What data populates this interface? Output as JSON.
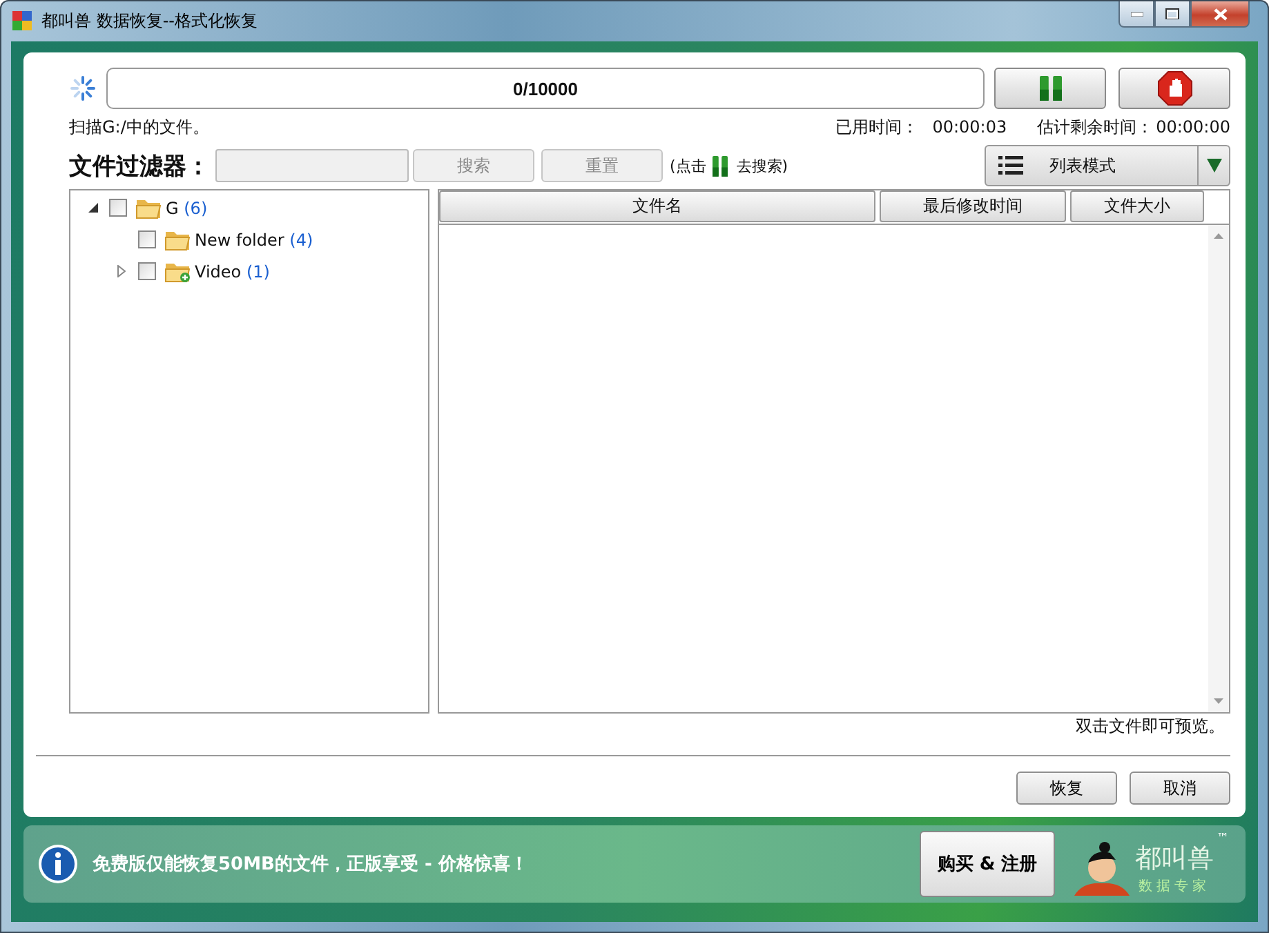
{
  "window": {
    "title": "都叫兽 数据恢复--格式化恢复"
  },
  "progress": {
    "text": "0/10000",
    "level": 0
  },
  "status": {
    "scan_text": "扫描G:/中的文件。",
    "elapsed_label": "已用时间：",
    "elapsed": "00:00:03",
    "remaining_label": "估计剩余时间：",
    "remaining": "00:00:00"
  },
  "filter": {
    "label": "文件过滤器：",
    "disabled": true,
    "search_button": "搜索",
    "reset_button": "重置",
    "hint_before": "(点击",
    "hint_after": "去搜索)"
  },
  "view_mode": {
    "label": "列表模式"
  },
  "tree": [
    {
      "label": "G",
      "count": "(6)",
      "checked": false,
      "expanded": true,
      "children": [
        {
          "label": "New folder",
          "count": "(4)",
          "checked": false
        },
        {
          "label": "Video",
          "count": "(1)",
          "checked": false,
          "expanded": false
        }
      ]
    }
  ],
  "table": {
    "columns": [
      "文件名",
      "最后修改时间",
      "文件大小"
    ]
  },
  "preview_hint": "双击文件即可预览。",
  "buttons": [
    {
      "label": "恢复"
    },
    {
      "label": "取消"
    }
  ],
  "promo": {
    "text": "免费版仅能恢复50MB的文件，正版享受 - 价格惊喜！",
    "buy_button": "购买 & 注册"
  },
  "logo": {
    "name": "都叫兽",
    "tagline": "数据专家",
    "trademark": "™"
  }
}
